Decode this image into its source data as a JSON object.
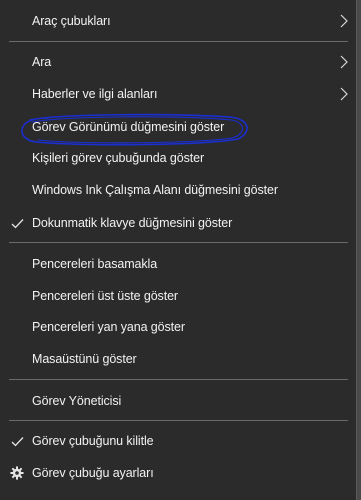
{
  "menu": {
    "items": [
      {
        "label": "Araç çubukları",
        "icon": "",
        "submenu": true
      },
      {
        "label": "Ara",
        "icon": "",
        "submenu": true
      },
      {
        "label": "Haberler ve ilgi alanları",
        "icon": "",
        "submenu": true
      },
      {
        "label": "Görev Görünümü düğmesini göster",
        "icon": "",
        "submenu": false
      },
      {
        "label": "Kişileri görev çubuğunda göster",
        "icon": "",
        "submenu": false
      },
      {
        "label": "Windows Ink Çalışma Alanı düğmesini göster",
        "icon": "",
        "submenu": false
      },
      {
        "label": "Dokunmatik klavye düğmesini göster",
        "icon": "checkmark-icon",
        "submenu": false
      },
      {
        "label": "Pencereleri basamakla",
        "icon": "",
        "submenu": false
      },
      {
        "label": "Pencereleri üst üste göster",
        "icon": "",
        "submenu": false
      },
      {
        "label": "Pencereleri yan yana göster",
        "icon": "",
        "submenu": false
      },
      {
        "label": "Masaüstünü göster",
        "icon": "",
        "submenu": false
      },
      {
        "label": "Görev Yöneticisi",
        "icon": "",
        "submenu": false
      },
      {
        "label": "Görev çubuğunu kilitle",
        "icon": "checkmark-icon",
        "submenu": false
      },
      {
        "label": "Görev çubuğu ayarları",
        "icon": "gear-icon",
        "submenu": false
      }
    ]
  },
  "annotation": {
    "color": "#1a2fd1",
    "shape": "hand-drawn ellipse around Görev Görünümü düğmesini göster"
  },
  "colors": {
    "menu_background": "#2b2b2b",
    "text": "#f2f2f2",
    "separator": "#6a6a6a"
  }
}
